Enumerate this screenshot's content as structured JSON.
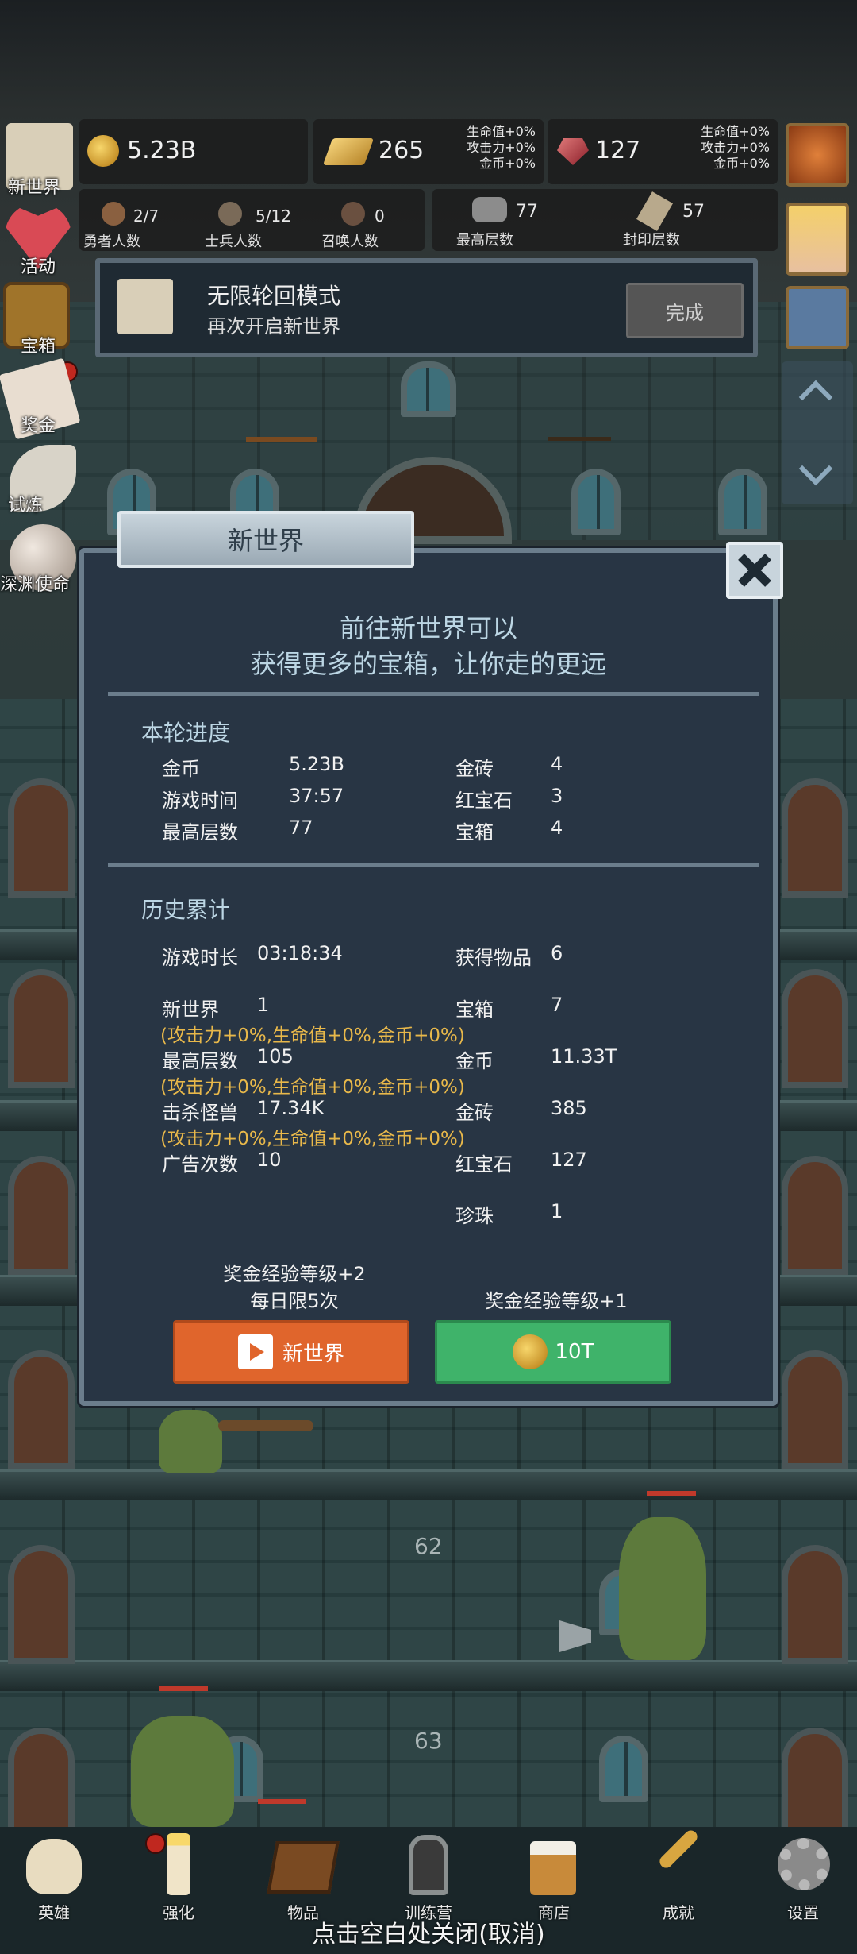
{
  "resources": {
    "gold": "5.23B",
    "gold_bar": "265",
    "gold_bar_bonus": [
      "生命值+0%",
      "攻击力+0%",
      "金币+0%"
    ],
    "ruby": "127",
    "ruby_bonus": [
      "生命值+0%",
      "攻击力+0%",
      "金币+0%"
    ]
  },
  "counts": {
    "hero": {
      "value": "2/7",
      "label": "勇者人数"
    },
    "soldier": {
      "value": "5/12",
      "label": "士兵人数"
    },
    "summon": {
      "value": "0",
      "label": "召唤人数"
    },
    "max_floor": {
      "value": "77",
      "label": "最高层数"
    },
    "seal_floor": {
      "value": "57",
      "label": "封印层数"
    }
  },
  "left_menu": [
    {
      "label": "新世界",
      "icon": "map-scroll-icon"
    },
    {
      "label": "活动",
      "icon": "heart-icon"
    },
    {
      "label": "宝箱",
      "icon": "treasure-chest-icon"
    },
    {
      "label": "奖金",
      "icon": "envelope-icon"
    },
    {
      "label": "试炼",
      "icon": "feather-icon"
    },
    {
      "label": "深渊使命",
      "icon": "orb-icon"
    }
  ],
  "mode_bar": {
    "title": "无限轮回模式",
    "subtitle": "再次开启新世界",
    "button": "完成"
  },
  "dialog": {
    "title": "新世界",
    "headline_1": "前往新世界可以",
    "headline_2": "获得更多的宝箱，让你走的更远",
    "round_section": "本轮进度",
    "round": [
      {
        "l1": "金币",
        "v1": "5.23B",
        "l2": "金砖",
        "v2": "4"
      },
      {
        "l1": "游戏时间",
        "v1": "37:57",
        "l2": "红宝石",
        "v2": "3"
      },
      {
        "l1": "最高层数",
        "v1": "77",
        "l2": "宝箱",
        "v2": "4"
      }
    ],
    "history_section": "历史累计",
    "history": {
      "play_time_label": "游戏时长",
      "play_time": "03:18:34",
      "items_label": "获得物品",
      "items": "6",
      "new_world_label": "新世界",
      "new_world": "1",
      "chest_label": "宝箱",
      "chest": "7",
      "new_world_bonus": "(攻击力+0%,生命值+0%,金币+0%)",
      "max_floor_label": "最高层数",
      "max_floor": "105",
      "gold_label": "金币",
      "gold": "11.33T",
      "max_floor_bonus": "(攻击力+0%,生命值+0%,金币+0%)",
      "kills_label": "击杀怪兽",
      "kills": "17.34K",
      "gold_bar_label": "金砖",
      "gold_bar": "385",
      "kills_bonus": "(攻击力+0%,生命值+0%,金币+0%)",
      "ads_label": "广告次数",
      "ads": "10",
      "ruby_label": "红宝石",
      "ruby": "127",
      "pearl_label": "珍珠",
      "pearl": "1"
    },
    "left_reward_1": "奖金经验等级+2",
    "left_reward_2": "每日限5次",
    "right_reward": "奖金经验等级+1",
    "video_button": "新世界",
    "coin_button": "10T"
  },
  "floors": [
    "62",
    "63"
  ],
  "nav": [
    {
      "label": "英雄",
      "icon": "skull-icon"
    },
    {
      "label": "强化",
      "icon": "candle-icon"
    },
    {
      "label": "物品",
      "icon": "book-icon"
    },
    {
      "label": "训练营",
      "icon": "lantern-icon"
    },
    {
      "label": "商店",
      "icon": "beer-mug-icon"
    },
    {
      "label": "成就",
      "icon": "key-icon"
    },
    {
      "label": "设置",
      "icon": "gear-icon"
    }
  ],
  "footer_hint": "点击空白处关闭(取消)",
  "colors": {
    "orange_button": "#e0652c",
    "green_button": "#3fb36a",
    "bonus_text": "#e8b84a"
  }
}
